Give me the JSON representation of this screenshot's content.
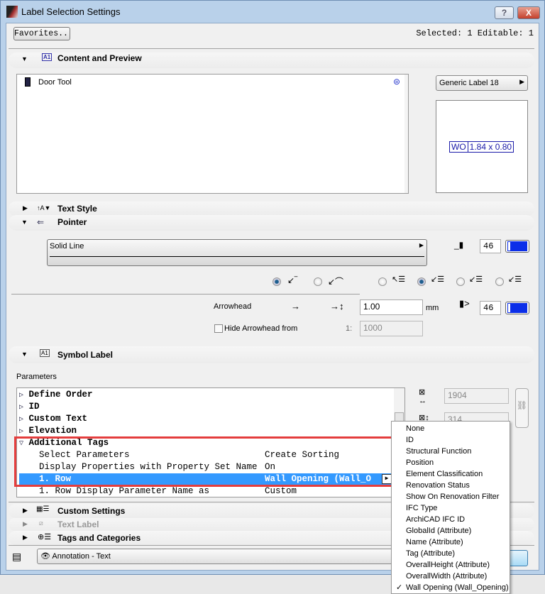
{
  "window": {
    "title": "Label Selection Settings",
    "help_label": "?",
    "close_label": "X"
  },
  "toolbar": {
    "favorites_label": "Favorites...",
    "selection_status": "Selected: 1 Editable: 1"
  },
  "content_preview": {
    "title": "Content and Preview",
    "list_item": "Door Tool",
    "label_type": "Generic Label 18",
    "preview": {
      "tag": "WO",
      "size": "1.84 x 0.80"
    }
  },
  "text_style": {
    "title": "Text Style"
  },
  "pointer": {
    "title": "Pointer",
    "line_type": "Solid Line",
    "pen": "46",
    "arrowhead_label": "Arrowhead",
    "arrowhead_size": "1.00",
    "unit": "mm",
    "arrowhead_pen": "46",
    "hide_arrowhead_label": "Hide Arrowhead from",
    "hide_scale_prefix": "1:",
    "hide_scale": "1000",
    "hide_checked": false,
    "pen_color": "#0b2ee8"
  },
  "symbol_label": {
    "title": "Symbol Label",
    "parameters_label": "Parameters",
    "params": [
      {
        "name": "Define Order",
        "value": ""
      },
      {
        "name": "ID",
        "value": ""
      },
      {
        "name": "Custom Text",
        "value": ""
      },
      {
        "name": "Elevation",
        "value": ""
      },
      {
        "name": "Additional Tags",
        "value": ""
      },
      {
        "name": "Select Parameters",
        "value": "Create Sorting"
      },
      {
        "name": "Display Properties with Property Set Name",
        "value": "On"
      },
      {
        "name": "1. Row",
        "value": "Wall Opening (Wall_O"
      },
      {
        "name": "1. Row Display Parameter Name as",
        "value": "Custom"
      }
    ],
    "width": "1904",
    "height": "314"
  },
  "dropdown_menu": {
    "items": [
      "None",
      "ID",
      "Structural Function",
      "Position",
      "Element Classification",
      "Renovation Status",
      "Show On Renovation Filter",
      "IFC Type",
      "ArchiCAD IFC ID",
      "GlobalId (Attribute)",
      "Name (Attribute)",
      "Tag (Attribute)",
      "OverallHeight (Attribute)",
      "OverallWidth (Attribute)",
      "Wall Opening (Wall_Opening)"
    ],
    "selected": "Wall Opening (Wall_Opening)",
    "check": "✓"
  },
  "sections": {
    "custom_settings": "Custom Settings",
    "text_label": "Text Label",
    "tags_categories": "Tags and Categories"
  },
  "footer": {
    "layer": "Annotation - Text"
  }
}
